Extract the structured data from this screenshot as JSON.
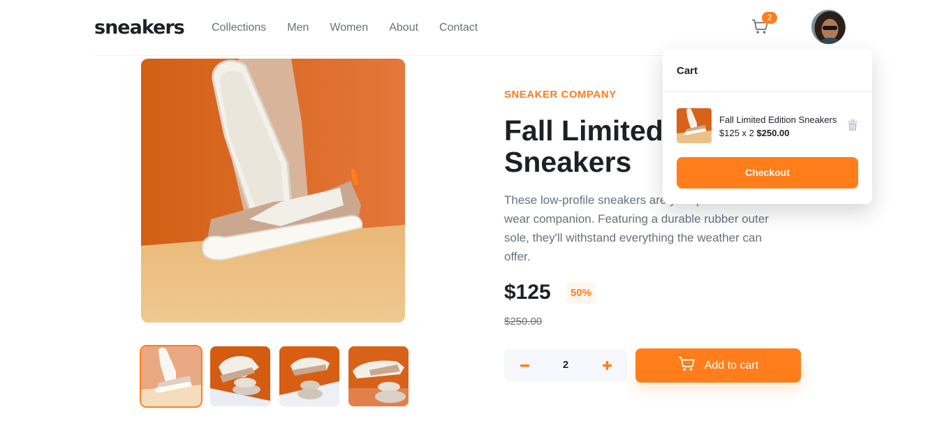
{
  "header": {
    "logo": "sneakers",
    "nav": [
      "Collections",
      "Men",
      "Women",
      "About",
      "Contact"
    ],
    "cart_count": "2"
  },
  "product": {
    "company": "SNEAKER COMPANY",
    "title": "Fall Limited Edition Sneakers",
    "description": "These low-profile sneakers are your perfect casual wear companion. Featuring a durable rubber outer sole, they'll withstand everything the weather can offer.",
    "price": "$125",
    "discount": "50%",
    "old_price": "$250.00",
    "quantity": "2",
    "add_to_cart": "Add to cart"
  },
  "cart": {
    "title": "Cart",
    "item_name": "Fall Limited Edition Sneakers",
    "item_price": "$125 x 2",
    "item_total": "$250.00",
    "checkout": "Checkout"
  },
  "colors": {
    "accent": "#ff7e1b",
    "dark": "#1d2026",
    "gray": "#69707d"
  },
  "icons": [
    "cart-icon",
    "trash-icon",
    "minus-icon",
    "plus-icon"
  ]
}
